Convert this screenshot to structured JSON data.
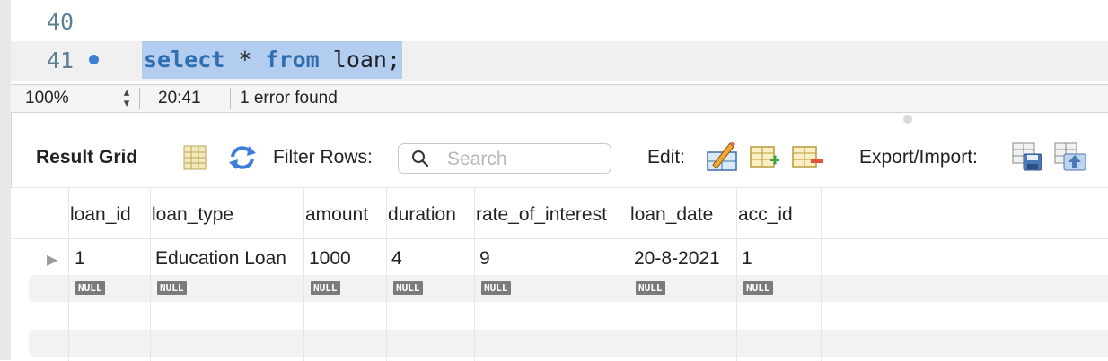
{
  "editor": {
    "lines": [
      {
        "number": "40",
        "code": ""
      },
      {
        "number": "41",
        "code_keyword1": "select",
        "code_star": "*",
        "code_keyword2": "from",
        "code_rest": "loan;"
      }
    ]
  },
  "statusbar": {
    "zoom": "100%",
    "cursor_position": "20:41",
    "error_text": "1 error found"
  },
  "toolbar": {
    "title": "Result Grid",
    "filter_label": "Filter Rows:",
    "search_placeholder": "Search",
    "edit_label": "Edit:",
    "export_label": "Export/Import:"
  },
  "grid": {
    "columns": [
      "loan_id",
      "loan_type",
      "amount",
      "duration",
      "rate_of_interest",
      "loan_date",
      "acc_id"
    ],
    "rows": [
      [
        "1",
        "Education Loan",
        "1000",
        "4",
        "9",
        "20-8-2021",
        "1"
      ]
    ],
    "null_row": [
      "NULL",
      "NULL",
      "NULL",
      "NULL",
      "NULL",
      "NULL",
      "NULL"
    ]
  },
  "colors": {
    "keyword": "#2f6fb0",
    "selection": "#b3cdf0",
    "breakpoint": "#3a7fd5"
  }
}
